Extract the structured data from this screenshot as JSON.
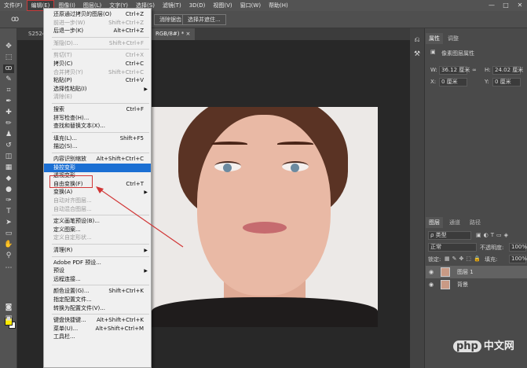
{
  "menubar": {
    "items": [
      "文件(F)",
      "编辑(E)",
      "图像(I)",
      "图层(L)",
      "文字(Y)",
      "选择(S)",
      "滤镜(T)",
      "3D(D)",
      "视图(V)",
      "窗口(W)",
      "帮助(H)"
    ],
    "active": "编辑(E)",
    "window_controls": [
      "—",
      "□",
      "✕"
    ]
  },
  "options_bar": {
    "feather_btn": "消除锯齿",
    "select_mask_btn": "选择并遮住..."
  },
  "doc_tabs": {
    "tab1": "S25242",
    "tab2": "RGB/8#) *",
    "close": "×"
  },
  "edit_menu": {
    "items": [
      {
        "label": "还原通过拷贝的图层(O)",
        "shortcut": "Ctrl+Z",
        "state": "normal"
      },
      {
        "label": "前进一步(W)",
        "shortcut": "Shift+Ctrl+Z",
        "state": "disabled"
      },
      {
        "label": "后退一步(K)",
        "shortcut": "Alt+Ctrl+Z",
        "state": "normal"
      },
      {
        "sep": true
      },
      {
        "label": "渐隐(D)...",
        "shortcut": "Shift+Ctrl+F",
        "state": "disabled"
      },
      {
        "sep": true
      },
      {
        "label": "剪切(T)",
        "shortcut": "Ctrl+X",
        "state": "disabled"
      },
      {
        "label": "拷贝(C)",
        "shortcut": "Ctrl+C",
        "state": "normal"
      },
      {
        "label": "合并拷贝(Y)",
        "shortcut": "Shift+Ctrl+C",
        "state": "disabled"
      },
      {
        "label": "粘贴(P)",
        "shortcut": "Ctrl+V",
        "state": "normal"
      },
      {
        "label": "选择性粘贴(I)",
        "shortcut": "",
        "state": "normal",
        "submenu": true
      },
      {
        "label": "清除(E)",
        "shortcut": "",
        "state": "disabled"
      },
      {
        "sep": true
      },
      {
        "label": "搜索",
        "shortcut": "Ctrl+F",
        "state": "normal"
      },
      {
        "label": "拼写检查(H)...",
        "shortcut": "",
        "state": "normal"
      },
      {
        "label": "查找和替换文本(X)...",
        "shortcut": "",
        "state": "normal"
      },
      {
        "sep": true
      },
      {
        "label": "填充(L)...",
        "shortcut": "Shift+F5",
        "state": "normal"
      },
      {
        "label": "描边(S)...",
        "shortcut": "",
        "state": "normal"
      },
      {
        "sep": true
      },
      {
        "label": "内容识别缩放",
        "shortcut": "Alt+Shift+Ctrl+C",
        "state": "normal"
      },
      {
        "label": "操控变形",
        "shortcut": "",
        "state": "highlighted"
      },
      {
        "label": "透视变形",
        "shortcut": "",
        "state": "normal"
      },
      {
        "label": "自由变换(F)",
        "shortcut": "Ctrl+T",
        "state": "normal"
      },
      {
        "label": "变换(A)",
        "shortcut": "",
        "state": "normal",
        "submenu": true
      },
      {
        "label": "自动对齐图层...",
        "shortcut": "",
        "state": "disabled"
      },
      {
        "label": "自动混合图层...",
        "shortcut": "",
        "state": "disabled"
      },
      {
        "sep": true
      },
      {
        "label": "定义画笔预设(B)...",
        "shortcut": "",
        "state": "normal"
      },
      {
        "label": "定义图案...",
        "shortcut": "",
        "state": "normal"
      },
      {
        "label": "定义自定形状...",
        "shortcut": "",
        "state": "disabled"
      },
      {
        "sep": true
      },
      {
        "label": "清理(R)",
        "shortcut": "",
        "state": "normal",
        "submenu": true
      },
      {
        "sep": true
      },
      {
        "label": "Adobe PDF 预设...",
        "shortcut": "",
        "state": "normal"
      },
      {
        "label": "预设",
        "shortcut": "",
        "state": "normal",
        "submenu": true
      },
      {
        "label": "远程连接...",
        "shortcut": "",
        "state": "normal"
      },
      {
        "sep": true
      },
      {
        "label": "颜色设置(G)...",
        "shortcut": "Shift+Ctrl+K",
        "state": "normal"
      },
      {
        "label": "指定配置文件...",
        "shortcut": "",
        "state": "normal"
      },
      {
        "label": "转换为配置文件(V)...",
        "shortcut": "",
        "state": "normal"
      },
      {
        "sep": true
      },
      {
        "label": "键盘快捷键...",
        "shortcut": "Alt+Shift+Ctrl+K",
        "state": "normal"
      },
      {
        "label": "菜单(U)...",
        "shortcut": "Alt+Shift+Ctrl+M",
        "state": "normal"
      },
      {
        "label": "工具栏...",
        "shortcut": "",
        "state": "normal"
      }
    ]
  },
  "properties_panel": {
    "tab_properties": "属性",
    "tab_adjust": "调整",
    "layer_type": "像素图层属性",
    "w_label": "W:",
    "w_value": "36.12 厘米",
    "link": "∞",
    "h_label": "H:",
    "h_value": "24.02 厘米",
    "x_label": "X:",
    "x_value": "0 厘米",
    "y_label": "Y:",
    "y_value": "0 厘米"
  },
  "layers_panel": {
    "tab_layers": "图层",
    "tab_channels": "通道",
    "tab_paths": "路径",
    "filter_kind": "ρ 类型",
    "blend_mode": "正常",
    "opacity_label": "不透明度:",
    "opacity_value": "100%",
    "lock_label": "锁定:",
    "fill_label": "填充:",
    "fill_value": "100%",
    "layers": [
      {
        "name": "图层 1",
        "selected": true
      },
      {
        "name": "背景",
        "selected": false
      }
    ]
  },
  "watermark": {
    "php": "php",
    "site": "中文网"
  },
  "colors": {
    "foreground": "#ffeb00",
    "background": "#ffffff",
    "highlight": "#1b6fd3",
    "annotation": "#d13636"
  },
  "icons": [
    "move-icon",
    "marquee-icon",
    "lasso-icon",
    "quick-select-icon",
    "crop-icon",
    "eyedropper-icon",
    "healing-icon",
    "brush-icon",
    "stamp-icon",
    "history-brush-icon",
    "eraser-icon",
    "gradient-icon",
    "blur-icon",
    "dodge-icon",
    "pen-icon",
    "type-icon",
    "path-select-icon",
    "shape-icon",
    "hand-icon",
    "zoom-icon",
    "edit-toolbar-icon"
  ]
}
